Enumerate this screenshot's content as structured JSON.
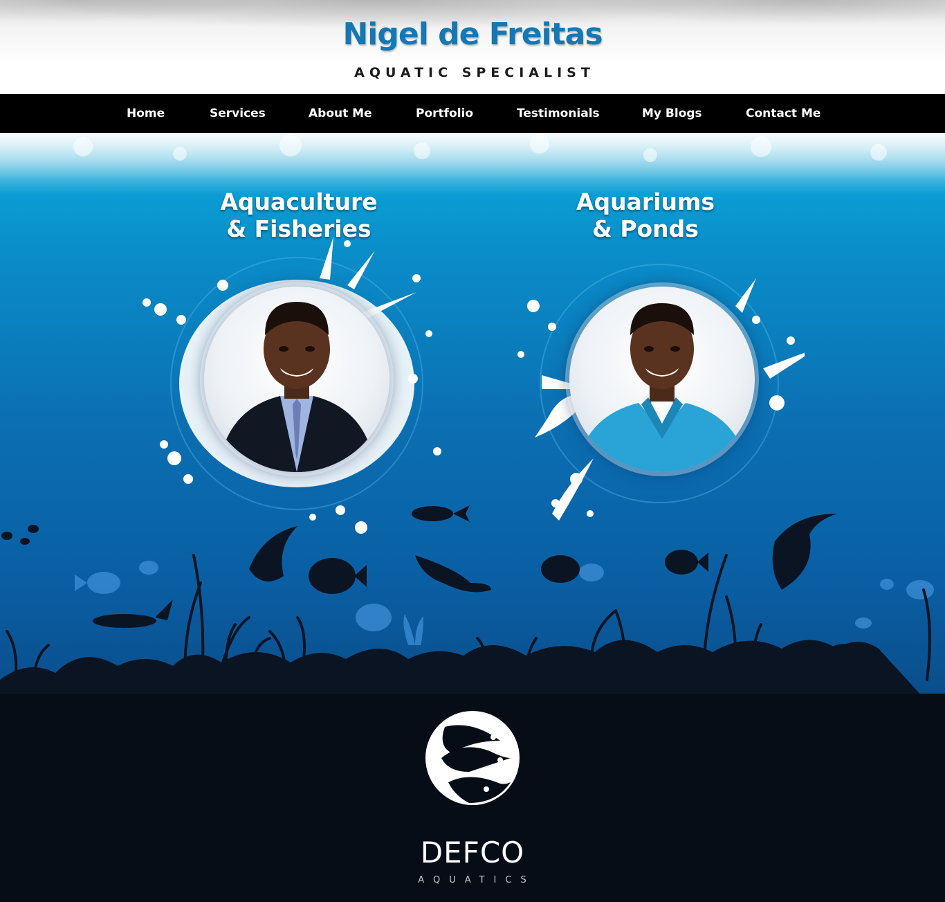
{
  "header": {
    "title": "Nigel de Freitas",
    "tagline": "AQUATIC SPECIALIST"
  },
  "nav": {
    "items": [
      {
        "label": "Home"
      },
      {
        "label": "Services"
      },
      {
        "label": "About Me"
      },
      {
        "label": "Portfolio"
      },
      {
        "label": "Testimonials"
      },
      {
        "label": "My Blogs"
      },
      {
        "label": "Contact Me"
      }
    ]
  },
  "services": [
    {
      "line1": "Aquaculture",
      "line2": "& Fisheries",
      "portrait_icon": "person-in-suit-photo"
    },
    {
      "line1": "Aquariums",
      "line2": "& Ponds",
      "portrait_icon": "person-in-polo-photo"
    }
  ],
  "footer": {
    "brand_name": "DEFCO",
    "brand_sub": "AQUATICS",
    "logo_icon": "fish-emblem-icon"
  },
  "colors": {
    "title_blue": "#1478b4",
    "nav_bg": "#000000",
    "ocean_blue": "#0a6fb2",
    "silhouette": "#0a1422"
  }
}
